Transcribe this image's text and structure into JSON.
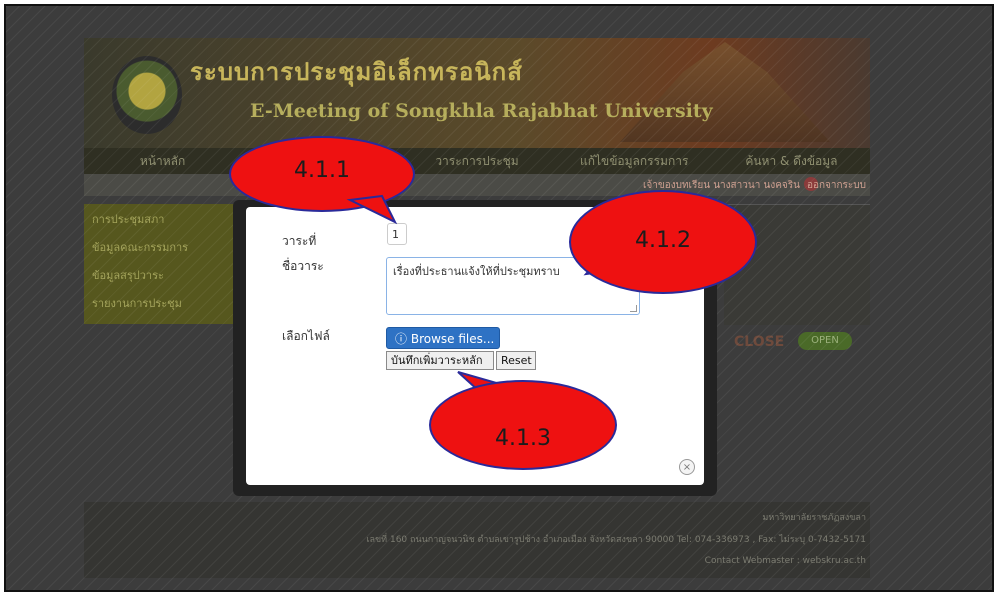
{
  "site": {
    "title_th": "ระบบการประชุมอิเล็กทรอนิกส์",
    "title_en": "E-Meeting of Songkhla Rajabhat University",
    "nav": [
      "หน้าหลัก",
      "",
      "วาระการประชุม",
      "แก้ไขข้อมูลกรรมการ",
      "ค้นหา & ดึงข้อมูล"
    ],
    "user_text": "เจ้าของบทเรียน นางสาวนา นงคจริน",
    "logout": "ออกจากระบบ",
    "sidebar_items": [
      "การประชุมสภา",
      "ข้อมูลคณะกรรมการ",
      "ข้อมูลสรุปวาระ",
      "รายงานการประชุม"
    ],
    "close_badge": "CLOSE",
    "green_badge": "OPEN",
    "footer_lines": [
      "มหาวิทยาลัยราชภัฏสงขลา",
      "เลขที่ 160 ถนนกาญจนวนิช ตำบลเขารูปช้าง อำเภอเมือง จังหวัดสงขลา 90000 Tel: 074-336973 , Fax: ไม่ระบุ 0-7432-5171",
      "Contact Webmaster : webskru.ac.th"
    ]
  },
  "modal": {
    "agenda_no_label": "วาระที่",
    "agenda_no_value": "1",
    "agenda_name_label": "ชื่อวาระ",
    "agenda_name_value": "เรื่องที่ประธานแจ้งให้ที่ประชุมทราบ",
    "file_label": "เลือกไฟล์",
    "browse_label": "Browse files...",
    "browse_icon": "upload-icon",
    "save_label": "บันทึกเพิ่มวาระหลัก",
    "reset_label": "Reset",
    "close_glyph": "×"
  },
  "callouts": [
    "4.1.1",
    "4.1.2",
    "4.1.3"
  ],
  "colors": {
    "callout_fill": "#ee1111",
    "callout_border": "#2a2a9a",
    "browse_button": "#2e72c4"
  }
}
